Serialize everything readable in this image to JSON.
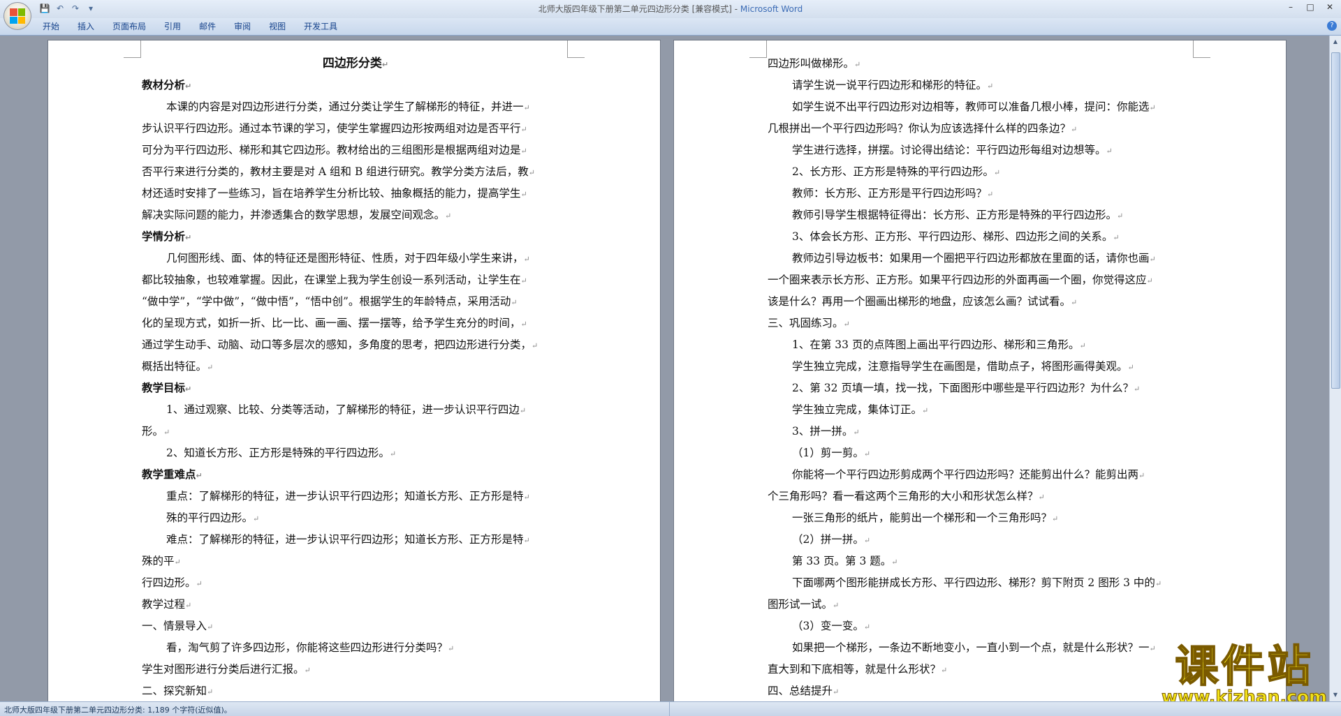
{
  "window": {
    "title_doc": "北师大版四年级下册第二单元四边形分类 [兼容模式] - ",
    "title_app": "Microsoft Word",
    "controls": [
      "–",
      "□",
      "✕"
    ]
  },
  "quick_access": {
    "save_icon": "💾",
    "undo_icon": "↶",
    "redo_icon": "↷",
    "dropdown_icon": "▾"
  },
  "ribbon": {
    "tabs": [
      "开始",
      "插入",
      "页面布局",
      "引用",
      "邮件",
      "审阅",
      "视图",
      "开发工具"
    ],
    "help_icon": "?"
  },
  "left_page": {
    "title": "四边形分类",
    "lines": [
      {
        "t": "教材分析",
        "k": "h"
      },
      {
        "t": "本课的内容是对四边形进行分类，通过分类让学生了解梯形的特征，并进一",
        "k": "ind"
      },
      {
        "t": "步认识平行四边形。通过本节课的学习，使学生掌握四边形按两组对边是否平行",
        "k": "p"
      },
      {
        "t": "可分为平行四边形、梯形和其它四边形。教材给出的三组图形是根据两组对边是",
        "k": "p"
      },
      {
        "t": "否平行来进行分类的，教材主要是对 A 组和 B 组进行研究。教学分类方法后，教",
        "k": "p"
      },
      {
        "t": "材还适时安排了一些练习，旨在培养学生分析比较、抽象概括的能力，提高学生",
        "k": "p"
      },
      {
        "t": "解决实际问题的能力，并渗透集合的数学思想，发展空间观念。",
        "k": "p"
      },
      {
        "t": "学情分析",
        "k": "h"
      },
      {
        "t": "几何图形线、面、体的特征还是图形特征、性质，对于四年级小学生来讲，",
        "k": "ind"
      },
      {
        "t": "都比较抽象，也较难掌握。因此，在课堂上我为学生创设一系列活动，让学生在",
        "k": "p"
      },
      {
        "t": "“做中学”，“学中做”，“做中悟”，“悟中创”。根据学生的年龄特点，采用活动",
        "k": "p"
      },
      {
        "t": "化的呈现方式，如折一折、比一比、画一画、摆一摆等，给予学生充分的时间，",
        "k": "p"
      },
      {
        "t": "通过学生动手、动脑、动口等多层次的感知，多角度的思考，把四边形进行分类，",
        "k": "p"
      },
      {
        "t": "概括出特征。",
        "k": "p"
      },
      {
        "t": "教学目标",
        "k": "h"
      },
      {
        "t": "1、通过观察、比较、分类等活动，了解梯形的特征，进一步认识平行四边",
        "k": "ind"
      },
      {
        "t": "形。",
        "k": "p"
      },
      {
        "t": "2、知道长方形、正方形是特殊的平行四边形。",
        "k": "ind"
      },
      {
        "t": "教学重难点",
        "k": "h"
      },
      {
        "t": "重点：了解梯形的特征，进一步认识平行四边形；知道长方形、正方形是特",
        "k": "ind"
      },
      {
        "t": "殊的平行四边形。",
        "k": "ind"
      },
      {
        "t": "难点：了解梯形的特征，进一步认识平行四边形；知道长方形、正方形是特",
        "k": "ind"
      },
      {
        "t": "殊的平",
        "k": "p"
      },
      {
        "t": "行四边形。",
        "k": "p"
      },
      {
        "t": "教学过程",
        "k": "p"
      },
      {
        "t": "一、情景导入",
        "k": "p"
      },
      {
        "t": "看，淘气剪了许多四边形，你能将这些四边形进行分类吗？",
        "k": "ind"
      },
      {
        "t": "学生对图形进行分类后进行汇报。",
        "k": "p"
      },
      {
        "t": "二、探究新知",
        "k": "p"
      }
    ]
  },
  "right_page": {
    "lines": [
      {
        "t": "四边形叫做梯形。",
        "k": "p"
      },
      {
        "t": "请学生说一说平行四边形和梯形的特征。",
        "k": "ind"
      },
      {
        "t": "如学生说不出平行四边形对边相等，教师可以准备几根小棒，提问：你能选",
        "k": "ind"
      },
      {
        "t": "几根拼出一个平行四边形吗？你认为应该选择什么样的四条边？",
        "k": "p"
      },
      {
        "t": "学生进行选择，拼摆。讨论得出结论：平行四边形每组对边想等。",
        "k": "ind"
      },
      {
        "t": "2、长方形、正方形是特殊的平行四边形。",
        "k": "ind"
      },
      {
        "t": "教师：长方形、正方形是平行四边形吗？",
        "k": "ind"
      },
      {
        "t": "教师引导学生根据特征得出：长方形、正方形是特殊的平行四边形。",
        "k": "ind"
      },
      {
        "t": "3、体会长方形、正方形、平行四边形、梯形、四边形之间的关系。",
        "k": "ind"
      },
      {
        "t": "教师边引导边板书：如果用一个圈把平行四边形都放在里面的话，请你也画",
        "k": "ind"
      },
      {
        "t": "一个圈来表示长方形、正方形。如果平行四边形的外面再画一个圈，你觉得这应",
        "k": "p"
      },
      {
        "t": "该是什么？再用一个圈画出梯形的地盘，应该怎么画？试试看。",
        "k": "p"
      },
      {
        "t": "三、巩固练习。",
        "k": "p"
      },
      {
        "t": "1、在第 33 页的点阵图上画出平行四边形、梯形和三角形。",
        "k": "ind"
      },
      {
        "t": "学生独立完成，注意指导学生在画图是，借助点子，将图形画得美观。",
        "k": "ind"
      },
      {
        "t": "2、第 32 页填一填，找一找，下面图形中哪些是平行四边形？为什么？",
        "k": "ind"
      },
      {
        "t": "学生独立完成，集体订正。",
        "k": "ind"
      },
      {
        "t": "3、拼一拼。",
        "k": "ind"
      },
      {
        "t": "（1）剪一剪。",
        "k": "ind"
      },
      {
        "t": "你能将一个平行四边形剪成两个平行四边形吗？还能剪出什么？能剪出两",
        "k": "ind"
      },
      {
        "t": "个三角形吗？看一看这两个三角形的大小和形状怎么样？",
        "k": "p"
      },
      {
        "t": "一张三角形的纸片，能剪出一个梯形和一个三角形吗？",
        "k": "ind"
      },
      {
        "t": "（2）拼一拼。",
        "k": "ind"
      },
      {
        "t": "第 33 页。第 3 题。",
        "k": "ind"
      },
      {
        "t": "下面哪两个图形能拼成长方形、平行四边形、梯形？剪下附页 2 图形 3 中的",
        "k": "ind"
      },
      {
        "t": "图形试一试。",
        "k": "p"
      },
      {
        "t": "（3）变一变。",
        "k": "ind"
      },
      {
        "t": "如果把一个梯形，一条边不断地变小，一直小到一个点，就是什么形状？一",
        "k": "ind"
      },
      {
        "t": "直大到和下底相等，就是什么形状？",
        "k": "p"
      },
      {
        "t": "四、总结提升",
        "k": "p"
      }
    ]
  },
  "status_bar": {
    "text": "北师大版四年级下册第二单元四边形分类: 1,189 个字符(近似值)。"
  },
  "watermark": {
    "title": "课件站",
    "url": "www.kjzhan.com"
  },
  "colors": {
    "ribbon_text": "#15428b",
    "app_title": "#3b6bb5",
    "doc_background": "#929aa8",
    "watermark": "#f3e31a"
  }
}
